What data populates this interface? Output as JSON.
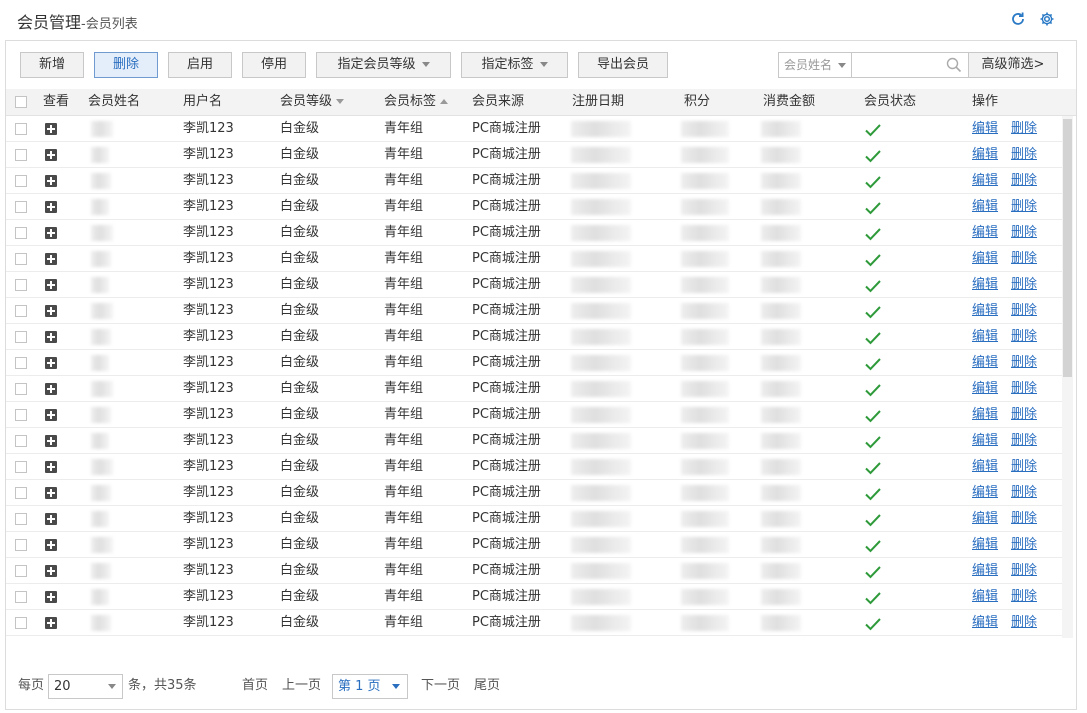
{
  "page": {
    "title": "会员管理",
    "separator": "-",
    "subtitle": "会员列表"
  },
  "icons": [
    "refresh-icon",
    "gear-icon",
    "search-icon",
    "plus-square-icon",
    "checkmark-icon"
  ],
  "colors": {
    "link": "#2a6ec0",
    "check": "#2e9a3a",
    "header_bg": "#f3f3f3",
    "active_button_bg": "#e4eefa"
  },
  "toolbar": {
    "add": "新增",
    "delete": "删除",
    "enable": "启用",
    "disable": "停用",
    "assign_level": "指定会员等级",
    "assign_tag": "指定标签",
    "export": "导出会员",
    "search_field": "会员姓名",
    "search_value": "",
    "advanced": "高级筛选>"
  },
  "columns": {
    "view": "查看",
    "name": "会员姓名",
    "username": "用户名",
    "level": "会员等级",
    "tag": "会员标签",
    "source": "会员来源",
    "reg_date": "注册日期",
    "points": "积分",
    "spend": "消费金额",
    "status": "会员状态",
    "actions": "操作"
  },
  "rows": [
    {
      "username": "李凯123",
      "level": "白金级",
      "tag": "青年组",
      "source": "PC商城注册",
      "status": "enabled",
      "edit": "编辑",
      "delete": "删除"
    },
    {
      "username": "李凯123",
      "level": "白金级",
      "tag": "青年组",
      "source": "PC商城注册",
      "status": "enabled",
      "edit": "编辑",
      "delete": "删除"
    },
    {
      "username": "李凯123",
      "level": "白金级",
      "tag": "青年组",
      "source": "PC商城注册",
      "status": "enabled",
      "edit": "编辑",
      "delete": "删除"
    },
    {
      "username": "李凯123",
      "level": "白金级",
      "tag": "青年组",
      "source": "PC商城注册",
      "status": "enabled",
      "edit": "编辑",
      "delete": "删除"
    },
    {
      "username": "李凯123",
      "level": "白金级",
      "tag": "青年组",
      "source": "PC商城注册",
      "status": "enabled",
      "edit": "编辑",
      "delete": "删除"
    },
    {
      "username": "李凯123",
      "level": "白金级",
      "tag": "青年组",
      "source": "PC商城注册",
      "status": "enabled",
      "edit": "编辑",
      "delete": "删除"
    },
    {
      "username": "李凯123",
      "level": "白金级",
      "tag": "青年组",
      "source": "PC商城注册",
      "status": "enabled",
      "edit": "编辑",
      "delete": "删除"
    },
    {
      "username": "李凯123",
      "level": "白金级",
      "tag": "青年组",
      "source": "PC商城注册",
      "status": "enabled",
      "edit": "编辑",
      "delete": "删除"
    },
    {
      "username": "李凯123",
      "level": "白金级",
      "tag": "青年组",
      "source": "PC商城注册",
      "status": "enabled",
      "edit": "编辑",
      "delete": "删除"
    },
    {
      "username": "李凯123",
      "level": "白金级",
      "tag": "青年组",
      "source": "PC商城注册",
      "status": "enabled",
      "edit": "编辑",
      "delete": "删除"
    },
    {
      "username": "李凯123",
      "level": "白金级",
      "tag": "青年组",
      "source": "PC商城注册",
      "status": "enabled",
      "edit": "编辑",
      "delete": "删除"
    },
    {
      "username": "李凯123",
      "level": "白金级",
      "tag": "青年组",
      "source": "PC商城注册",
      "status": "enabled",
      "edit": "编辑",
      "delete": "删除"
    },
    {
      "username": "李凯123",
      "level": "白金级",
      "tag": "青年组",
      "source": "PC商城注册",
      "status": "enabled",
      "edit": "编辑",
      "delete": "删除"
    },
    {
      "username": "李凯123",
      "level": "白金级",
      "tag": "青年组",
      "source": "PC商城注册",
      "status": "enabled",
      "edit": "编辑",
      "delete": "删除"
    },
    {
      "username": "李凯123",
      "level": "白金级",
      "tag": "青年组",
      "source": "PC商城注册",
      "status": "enabled",
      "edit": "编辑",
      "delete": "删除"
    },
    {
      "username": "李凯123",
      "level": "白金级",
      "tag": "青年组",
      "source": "PC商城注册",
      "status": "enabled",
      "edit": "编辑",
      "delete": "删除"
    },
    {
      "username": "李凯123",
      "level": "白金级",
      "tag": "青年组",
      "source": "PC商城注册",
      "status": "enabled",
      "edit": "编辑",
      "delete": "删除"
    },
    {
      "username": "李凯123",
      "level": "白金级",
      "tag": "青年组",
      "source": "PC商城注册",
      "status": "enabled",
      "edit": "编辑",
      "delete": "删除"
    },
    {
      "username": "李凯123",
      "level": "白金级",
      "tag": "青年组",
      "source": "PC商城注册",
      "status": "enabled",
      "edit": "编辑",
      "delete": "删除"
    },
    {
      "username": "李凯123",
      "level": "白金级",
      "tag": "青年组",
      "source": "PC商城注册",
      "status": "enabled",
      "edit": "编辑",
      "delete": "删除"
    }
  ],
  "pager": {
    "per_page_label": "每页",
    "per_page": "20",
    "total_text": "条，共35条",
    "first": "首页",
    "prev": "上一页",
    "current": "第 1 页",
    "next": "下一页",
    "last": "尾页"
  }
}
